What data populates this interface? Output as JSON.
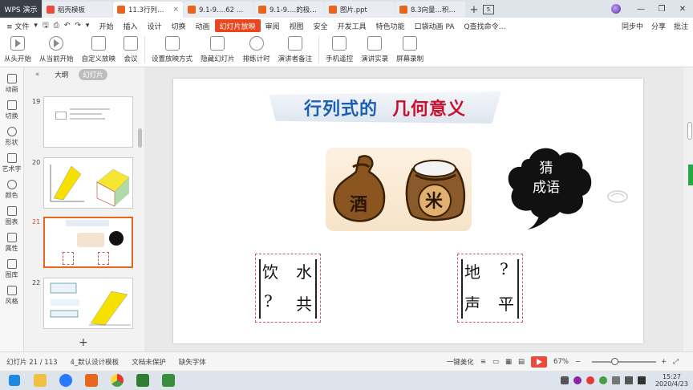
{
  "titlebar": {
    "app_label": "WPS 演示",
    "tabs": [
      {
        "label": "稻壳模板",
        "color": "#e84c3d",
        "active": false
      },
      {
        "label": "11.3行列式.ppt",
        "color": "#e8651e",
        "active": true
      },
      {
        "label": "9.1-9.…62 备份]",
        "color": "#e8651e",
        "active": false
      },
      {
        "label": "9.1-9.…的极限与连续",
        "color": "#e8651e",
        "active": false
      },
      {
        "label": "图片.ppt",
        "color": "#e8651e",
        "active": false
      },
      {
        "label": "8.3向量…积和向量积",
        "color": "#e8651e",
        "active": false
      }
    ],
    "tab_count": "5",
    "add_tab": "+"
  },
  "menubar": {
    "file_label": "≡ 文件",
    "items": [
      "开始",
      "插入",
      "设计",
      "切换",
      "动画",
      "幻灯片放映",
      "审阅",
      "视图",
      "安全",
      "开发工具",
      "特色功能",
      "口袋动画 PA"
    ],
    "active_item": "幻灯片放映",
    "search": "Q查找命令…",
    "sync": "同步中",
    "share": "分享",
    "comment": "批注"
  },
  "ribbon": {
    "buttons": [
      "从头开始",
      "从当前开始",
      "自定义放映",
      "会议",
      "设置放映方式",
      "隐藏幻灯片",
      "排练计时",
      "演讲者备注",
      "手机遥控",
      "演讲实录",
      "屏幕录制"
    ]
  },
  "toolstrip": {
    "items": [
      "动画",
      "切换",
      "形状",
      "艺术字",
      "颜色",
      "图表",
      "属性",
      "图库",
      "风格"
    ]
  },
  "thumbpanel": {
    "tab_outline": "大纲",
    "tab_slides": "幻灯片",
    "thumbs": [
      {
        "num": "19",
        "active": false
      },
      {
        "num": "20",
        "active": false
      },
      {
        "num": "21",
        "active": true
      },
      {
        "num": "22",
        "active": false
      }
    ],
    "add": "+"
  },
  "slide": {
    "title_part1": "行列式的",
    "title_part2": "几何意义",
    "picture_chars": [
      "酒",
      "米"
    ],
    "cloud_line1": "猜",
    "cloud_line2": "成语",
    "left_box": {
      "r1c1": "饮",
      "r1c2": "水",
      "r2c1": "?",
      "r2c2": "共"
    },
    "right_box": {
      "r1c1": "地",
      "r1c2": "?",
      "r2c1": "声",
      "r2c2": "平"
    }
  },
  "statusbar": {
    "slide_pos": "幻灯片 21 / 113",
    "template": "4_默认设计模板",
    "protect": "文档未保护",
    "font_missing": "缺失字体",
    "beautify": "一键美化",
    "zoom": "67%"
  },
  "taskbar": {
    "time": "15:27",
    "date": "2020/4/23"
  }
}
